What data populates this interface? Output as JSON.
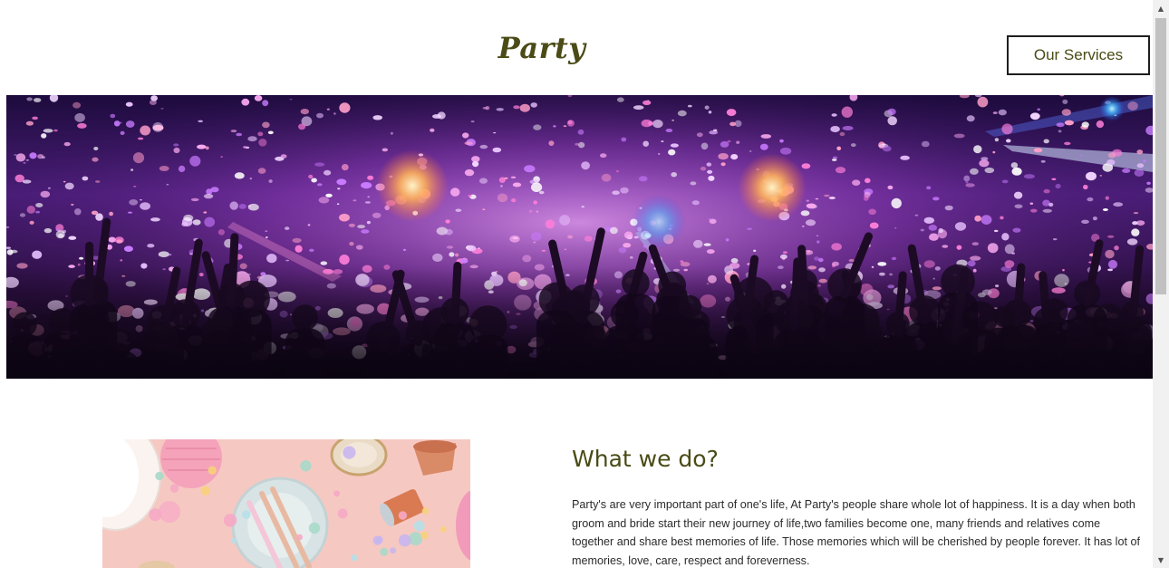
{
  "header": {
    "logo_text": "Party",
    "services_button_label": "Our Services"
  },
  "hero": {
    "image_alt": "party crowd with confetti and stage lights"
  },
  "section": {
    "title": "What we do?",
    "body": "Party's are very important part of one's life, At Party's people share whole lot of happiness. It is a day when both groom and bride start their new journey of life,two families become one, many friends and relatives come together and share best memories of life. Those memories which will be cherished by people forever. It has lot of memories, love, care, respect and foreverness.",
    "image_alt": "party table with plates, cups and confetti"
  },
  "scrollbar": {
    "up_icon": "▲",
    "down_icon": "▼"
  },
  "colors": {
    "accent_olive": "#4a4b16",
    "body_text": "#2b2b2b",
    "button_border": "#1e1e1e"
  }
}
